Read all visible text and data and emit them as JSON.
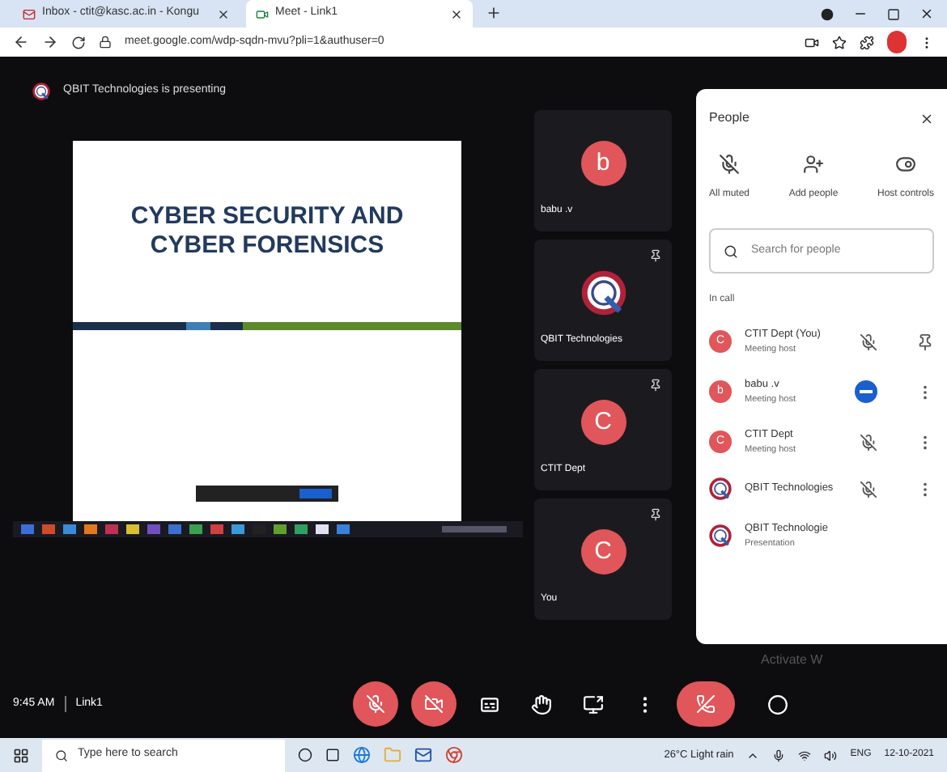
{
  "browser": {
    "tabs": [
      {
        "title": "Inbox - ctit@kasc.ac.in - Kongu",
        "selected": false
      },
      {
        "title": "Meet - Link1",
        "selected": true
      }
    ],
    "url": "meet.google.com/wdp-sqdn-mvu?pli=1&authuser=0"
  },
  "meet": {
    "banner": "QBIT Technologies is presenting",
    "slide": {
      "title": "CYBER SECURITY AND CYBER FORENSICS"
    },
    "tiles": [
      {
        "name": "babu .v",
        "initial": "b",
        "kind": "letter",
        "pinnable": false
      },
      {
        "name": "QBIT Technologies",
        "kind": "logo",
        "pinnable": true
      },
      {
        "name": "CTIT Dept",
        "initial": "C",
        "kind": "letter",
        "pinnable": true
      },
      {
        "name": "You",
        "initial": "C",
        "kind": "letter",
        "pinnable": true
      }
    ],
    "time": "9:45 AM",
    "meeting": "Link1",
    "controls": [
      {
        "kind": "mic",
        "off": true
      },
      {
        "kind": "camera",
        "off": true
      },
      {
        "kind": "captions",
        "off": false
      },
      {
        "kind": "hand",
        "off": false
      },
      {
        "kind": "present",
        "off": false
      },
      {
        "kind": "more",
        "off": false
      },
      {
        "kind": "hangup"
      }
    ],
    "watermark_text": "Activate W"
  },
  "people": {
    "title": "People",
    "actions": [
      {
        "kind": "mute",
        "label": "All muted"
      },
      {
        "kind": "add",
        "label": "Add people"
      },
      {
        "kind": "host",
        "label": "Host controls"
      }
    ],
    "search": {
      "placeholder": "Search for people"
    },
    "section": "In call",
    "participants": [
      {
        "name": "CTIT Dept (You)",
        "role": "Meeting host",
        "kind": "letter",
        "initial": "C",
        "muted": true,
        "self": true
      },
      {
        "name": "babu .v",
        "role": "Meeting host",
        "kind": "letter",
        "initial": "b",
        "muted": false,
        "self": false
      },
      {
        "name": "CTIT Dept",
        "role": "Meeting host",
        "kind": "letter",
        "initial": "C",
        "muted": true,
        "self": false
      },
      {
        "name": "QBIT Technologies",
        "kind": "logo",
        "muted": true,
        "self": false
      },
      {
        "name": "QBIT Technologie",
        "role": "Presentation",
        "kind": "presentation"
      }
    ]
  },
  "taskbar": {
    "search_placeholder": "Type here to search",
    "weather": "26°C Light rain",
    "language": "ENG",
    "date": "12-10-2021"
  }
}
